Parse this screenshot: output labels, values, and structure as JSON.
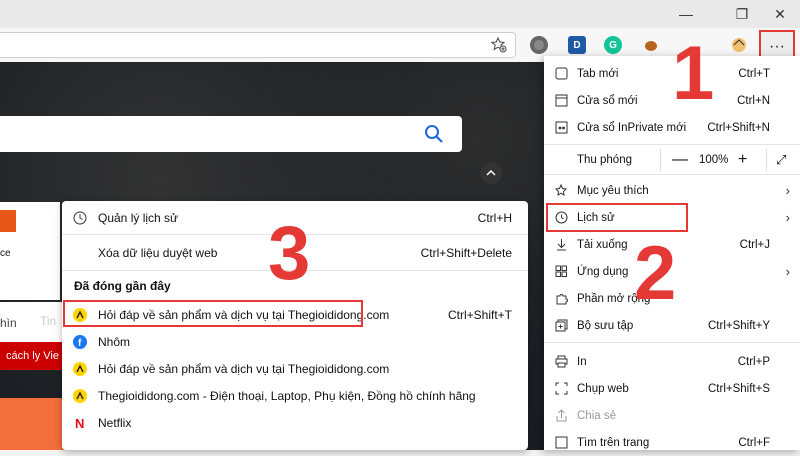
{
  "window": {
    "minimize": "—",
    "maximize": "❐",
    "close": "✕"
  },
  "toolbar": {
    "favorite_icon": "star-plus-icon",
    "extensions": [
      {
        "name": "puzzle-icon",
        "letter": "",
        "color": "#555555"
      },
      {
        "name": "dashlane-icon",
        "letter": "D",
        "color": "#1f5aa6"
      },
      {
        "name": "grammarly-icon",
        "letter": "G",
        "color": "#15c39a"
      },
      {
        "name": "cookie-icon",
        "letter": "",
        "color": "#b5651d"
      }
    ],
    "more_label": "···"
  },
  "page": {
    "tile_label": "ce",
    "tab_partial": "hìn",
    "tab_partial2": "Tin",
    "banner_text": "cách ly Vie"
  },
  "history": {
    "manage": {
      "label": "Quản lý lịch sử",
      "shortcut": "Ctrl+H"
    },
    "clear": {
      "label": "Xóa dữ liệu duyệt web",
      "shortcut": "Ctrl+Shift+Delete"
    },
    "section_title": "Đã đóng gần đây",
    "items": [
      {
        "label": "Hỏi đáp về sản phẩm và dịch vụ tại Thegioididong.com",
        "shortcut": "Ctrl+Shift+T",
        "icon": "tgdd"
      },
      {
        "label": "Nhôm",
        "shortcut": "",
        "icon": "facebook"
      },
      {
        "label": "Hỏi đáp về sản phẩm và dịch vụ tại Thegioididong.com",
        "shortcut": "",
        "icon": "tgdd"
      },
      {
        "label": "Thegioididong.com - Điện thoại, Laptop, Phụ kiện, Đồng hồ chính hãng",
        "shortcut": "",
        "icon": "tgdd"
      },
      {
        "label": "Netflix",
        "shortcut": "",
        "icon": "netflix"
      }
    ]
  },
  "menu": {
    "new_tab": {
      "label": "Tab mới",
      "shortcut": "Ctrl+T"
    },
    "new_window": {
      "label": "Cửa sổ mới",
      "shortcut": "Ctrl+N"
    },
    "inprivate": {
      "label": "Cửa sổ InPrivate mới",
      "shortcut": "Ctrl+Shift+N"
    },
    "zoom": {
      "label": "Thu phóng",
      "minus": "—",
      "value": "100%",
      "plus": "+"
    },
    "favorites": {
      "label": "Mục yêu thích"
    },
    "history": {
      "label": "Lịch sử"
    },
    "downloads": {
      "label": "Tải xuống",
      "shortcut": "Ctrl+J"
    },
    "apps": {
      "label": "Ứng dụng"
    },
    "extensions": {
      "label": "Phần mở rộng"
    },
    "collections": {
      "label": "Bộ sưu tập",
      "shortcut": "Ctrl+Shift+Y"
    },
    "print": {
      "label": "In",
      "shortcut": "Ctrl+P"
    },
    "capture": {
      "label": "Chụp web",
      "shortcut": "Ctrl+Shift+S"
    },
    "share": {
      "label": "Chia sẻ"
    },
    "find": {
      "label": "Tìm trên trang",
      "shortcut": "Ctrl+F"
    }
  },
  "annotations": {
    "one": "1",
    "two": "2",
    "three": "3"
  },
  "colors": {
    "highlight": "#e53935",
    "menu_bg": "#ffffff",
    "page_bg": "#1a1d22"
  }
}
